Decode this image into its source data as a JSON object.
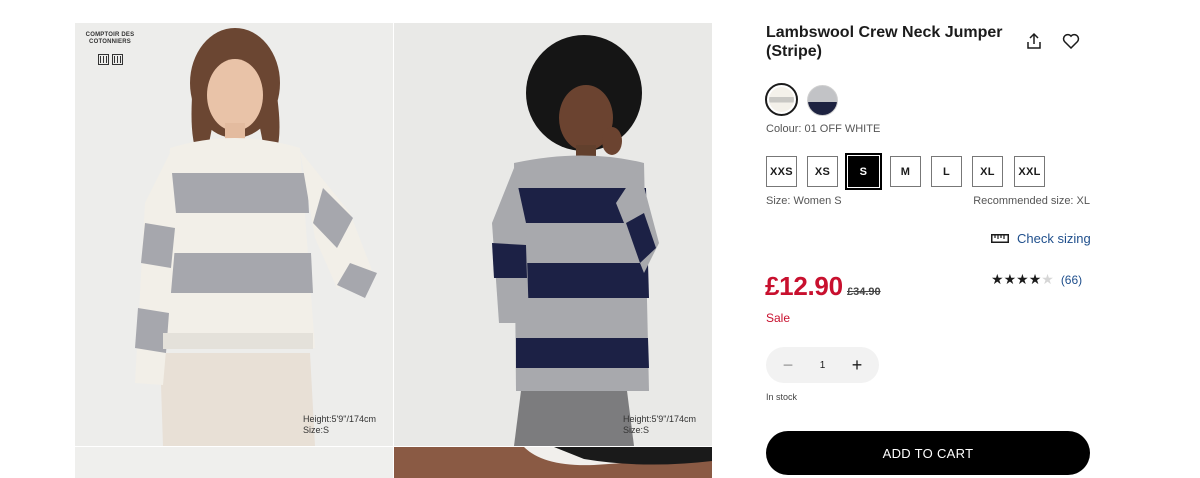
{
  "gallery": {
    "brand_line1": "COMPTOIR DES",
    "brand_line2": "COTONNIERS",
    "photo1_note": "Height:5'9\"/174cm\nSize:S",
    "photo1_height": "Height:5'9\"/174cm",
    "photo1_size": "Size:S",
    "photo2_height": "Height:5'9\"/174cm",
    "photo2_size": "Size:S"
  },
  "product": {
    "title": "Lambswool Crew Neck Jumper (Stripe)",
    "colour_label": "Colour: 01 OFF WHITE",
    "swatches": [
      {
        "name": "off-white-stripe",
        "color": "#f4f1ea"
      },
      {
        "name": "navy-stripe",
        "color": "#1d2240"
      }
    ],
    "sizes": [
      "XXS",
      "XS",
      "S",
      "M",
      "L",
      "XL",
      "XXL"
    ],
    "selected_size": "S",
    "size_label": "Size: Women S",
    "recommended_size": "Recommended size: XL",
    "check_sizing": "Check sizing",
    "price": "£12.90",
    "original_price": "£34.90",
    "sale_label": "Sale",
    "rating": 4,
    "rating_max": 5,
    "review_count": "(66)",
    "quantity": "1",
    "stock_status": "In stock",
    "add_to_cart": "ADD TO CART"
  },
  "icons": {
    "share": "share-icon",
    "favorite": "heart-icon",
    "ruler": "ruler-icon",
    "minus": "minus-icon",
    "plus": "plus-icon"
  },
  "colors": {
    "accent_red": "#c8102e",
    "link_blue": "#1f4f8c",
    "button_black": "#000000"
  }
}
